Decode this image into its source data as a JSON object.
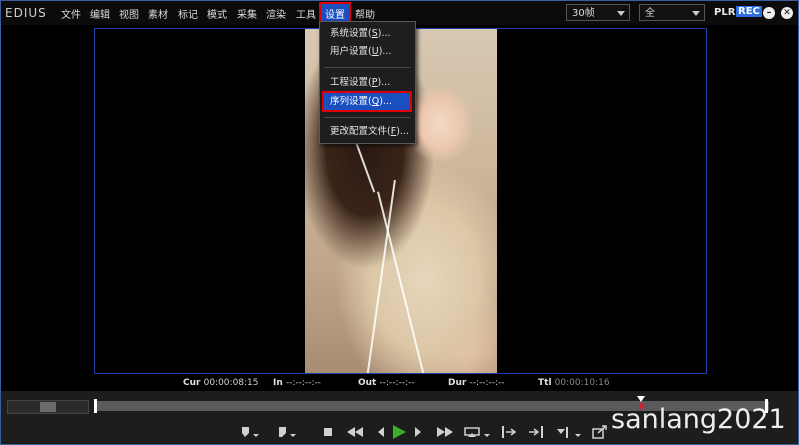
{
  "app": {
    "logo": "EDIUS"
  },
  "menubar": {
    "items": [
      "文件",
      "编辑",
      "视图",
      "素材",
      "标记",
      "模式",
      "采集",
      "渲染",
      "工具",
      "设置",
      "帮助"
    ],
    "active_index": 9,
    "framerate_select": "30帧",
    "view_select": "全",
    "plr": "PLR",
    "rec": "REC",
    "minimize_symbol": "–",
    "close_symbol": "✕"
  },
  "settings_menu": {
    "items": [
      {
        "label": "系统设置(",
        "key": "S",
        "suffix": ")..."
      },
      {
        "label": "用户设置(",
        "key": "U",
        "suffix": ")..."
      },
      {
        "label": "工程设置(",
        "key": "P",
        "suffix": ")..."
      },
      {
        "label": "序列设置(",
        "key": "Q",
        "suffix": ")..."
      },
      {
        "label": "更改配置文件(",
        "key": "F",
        "suffix": ")..."
      }
    ],
    "highlighted_index": 3
  },
  "timecodes": {
    "cur_label": "Cur",
    "cur_value": "00:00:08:15",
    "in_label": "In",
    "in_value": "--:--:--:--",
    "out_label": "Out",
    "out_value": "--:--:--:--",
    "dur_label": "Dur",
    "dur_value": "--:--:--:--",
    "ttl_label": "Ttl",
    "ttl_value": "00:00:10:16"
  },
  "playback": {
    "position_fraction": 0.81
  },
  "transport": {
    "icons": [
      "set-in-icon",
      "set-out-icon",
      "stop-icon",
      "rewind-icon",
      "step-back-icon",
      "play-icon",
      "step-forward-icon",
      "fast-forward-icon",
      "loop-icon",
      "jump-in-icon",
      "jump-out-icon",
      "mark-icon",
      "export-icon"
    ],
    "accent_color": "#3fae2a"
  },
  "watermark": "sanlang2021",
  "colors": {
    "menu_highlight": "#1a4fbf",
    "annotation_red": "#e00000",
    "viewer_border": "#1c3fa8"
  }
}
